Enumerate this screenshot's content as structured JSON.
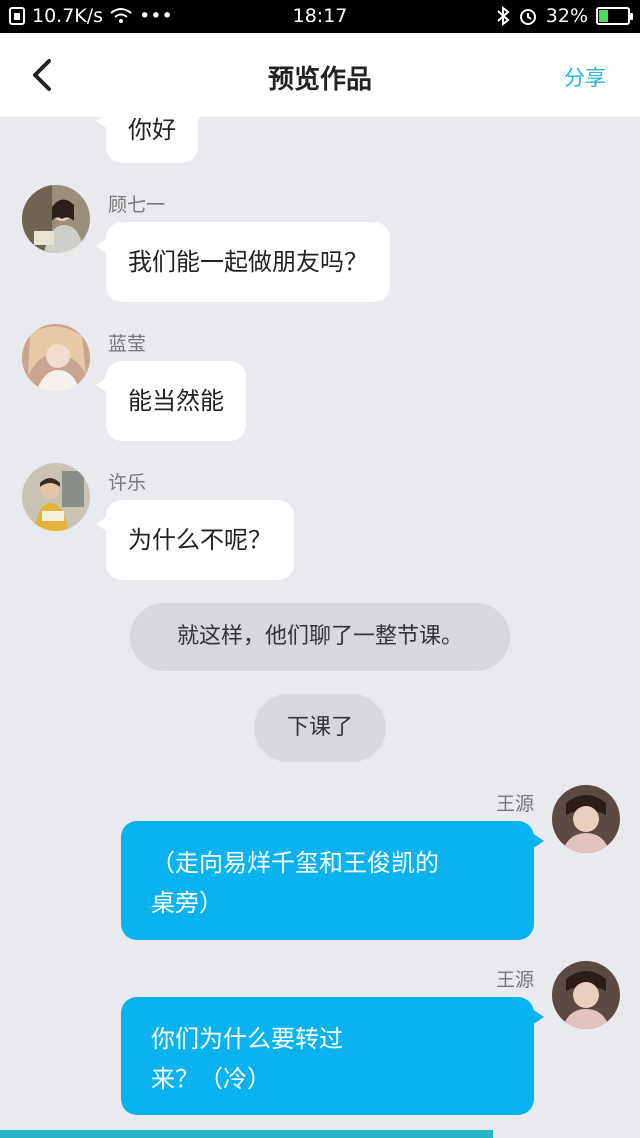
{
  "status_bar": {
    "network_speed": "10.7K/s",
    "dots": "•••",
    "time": "18:17",
    "battery_percent": "32%",
    "battery_level": 0.32
  },
  "header": {
    "title": "预览作品",
    "share_label": "分享"
  },
  "messages": {
    "m0": {
      "text": "你好"
    },
    "m1": {
      "name": "顾七一",
      "text": "我们能一起做朋友吗？"
    },
    "m2": {
      "name": "蓝莹",
      "text": "能当然能"
    },
    "m3": {
      "name": "许乐",
      "text": "为什么不呢？"
    },
    "n1": {
      "text": "就这样，他们聊了一整节课。"
    },
    "n2": {
      "text": "下课了"
    },
    "m4": {
      "name": "王源",
      "line1": "（走向易烊千玺和王俊凯的",
      "line2": "桌旁）"
    },
    "m5": {
      "name": "王源",
      "line1": "你们为什么要转过",
      "line2": "来？（冷）"
    }
  },
  "progress": {
    "value": 0.77
  },
  "colors": {
    "accent": "#27b6d8",
    "bubble_right": "#0ab3ef",
    "background": "#e9eaee"
  }
}
